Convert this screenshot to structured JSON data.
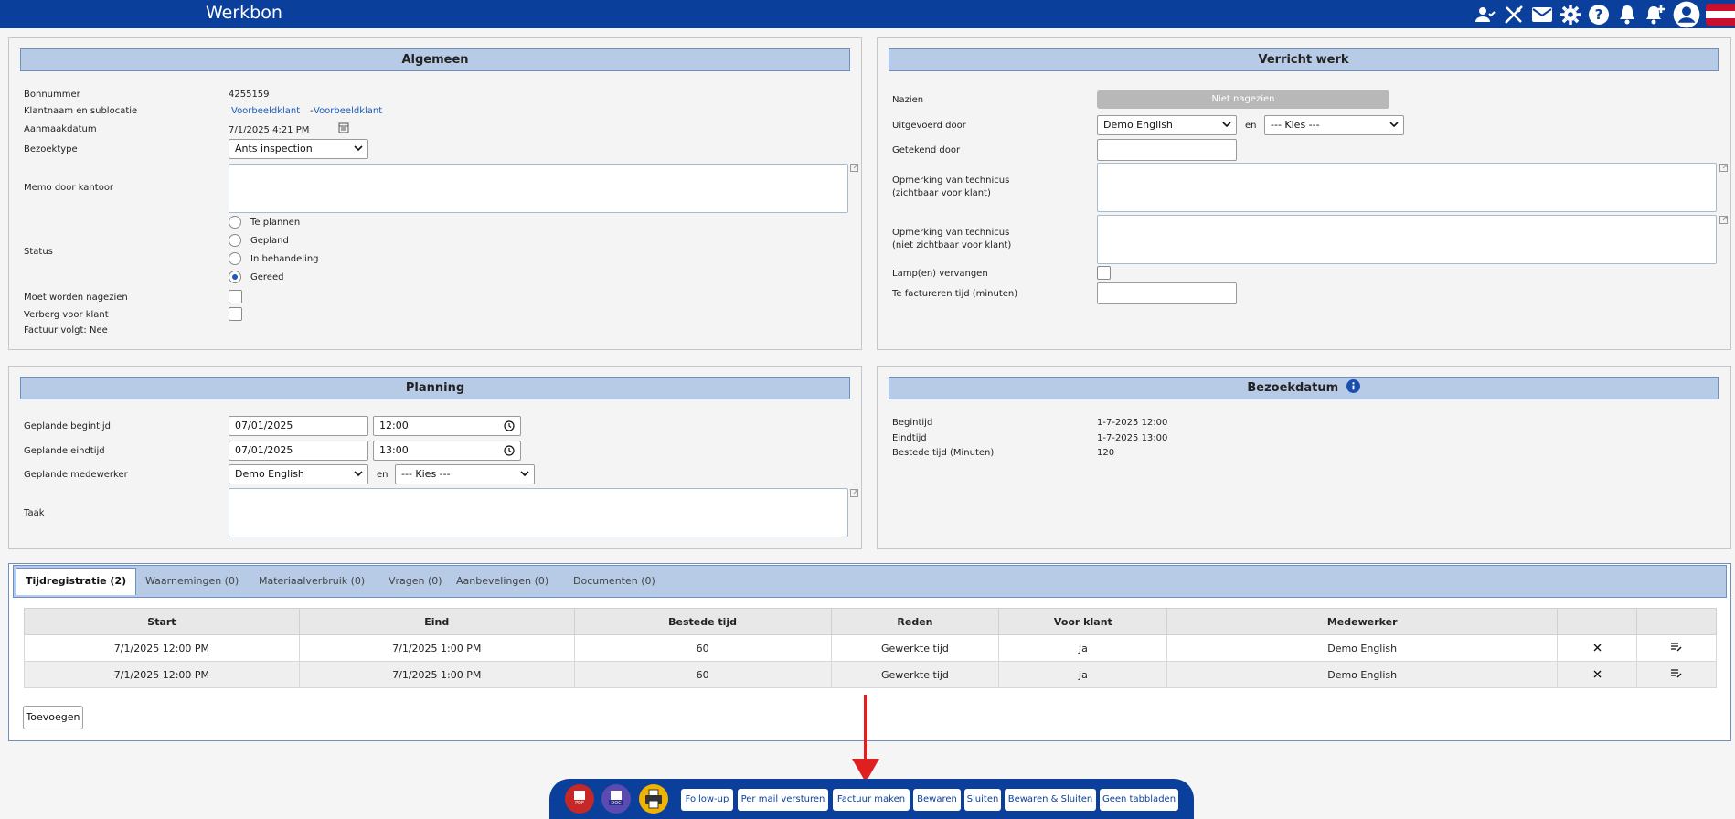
{
  "header": {
    "title": "Werkbon",
    "icons": [
      "users-icon",
      "tools-icon",
      "mail-icon",
      "gear-icon",
      "help-icon",
      "bell-icon",
      "bell-plus-icon",
      "account-icon",
      "flag-nl-icon"
    ]
  },
  "algemeen": {
    "title": "Algemeen",
    "bonnummer_label": "Bonnummer",
    "bonnummer": "4255159",
    "klant_label": "Klantnaam en sublocatie",
    "klant_name": "Voorbeeldklant",
    "klant_sep": "-",
    "klant_sublocation": "Voorbeeldklant",
    "aanmaak_label": "Aanmaakdatum",
    "aanmaak_value": "7/1/2025 4:21 PM",
    "bezoektype_label": "Bezoektype",
    "bezoektype_value": "Ants inspection",
    "memo_label": "Memo door kantoor",
    "status_label": "Status",
    "status_options": [
      "Te plannen",
      "Gepland",
      "In behandeling",
      "Gereed"
    ],
    "status_selected": "Gereed",
    "nagezien_label": "Moet worden nagezien",
    "verberg_label": "Verberg voor klant",
    "factuur_label": "Factuur volgt: Nee"
  },
  "verricht": {
    "title": "Verricht werk",
    "nazien_label": "Nazien",
    "nazien_button": "Niet nagezien",
    "uitgevoerd_label": "Uitgevoerd door",
    "uitgevoerd_value": "Demo English",
    "en": "en",
    "kies": "--- Kies ---",
    "getekend_label": "Getekend door",
    "opm1_line1": "Opmerking van technicus",
    "opm1_line2": "(zichtbaar voor klant)",
    "opm2_line1": "Opmerking van technicus",
    "opm2_line2": "(niet zichtbaar voor klant)",
    "lamp_label": "Lamp(en) vervangen",
    "factureren_label": "Te factureren tijd (minuten)"
  },
  "planning": {
    "title": "Planning",
    "begin_label": "Geplande begintijd",
    "begin_date": "07/01/2025",
    "begin_time": "12:00",
    "eind_label": "Geplande eindtijd",
    "eind_date": "07/01/2025",
    "eind_time": "13:00",
    "medewerker_label": "Geplande medewerker",
    "medewerker_value": "Demo English",
    "en": "en",
    "kies": "--- Kies ---",
    "taak_label": "Taak"
  },
  "bezoekdatum": {
    "title": "Bezoekdatum",
    "begintijd_label": "Begintijd",
    "begintijd": "1-7-2025 12:00",
    "eindtijd_label": "Eindtijd",
    "eindtijd": "1-7-2025 13:00",
    "bestede_label": "Bestede tijd (Minuten)",
    "bestede": "120"
  },
  "tabs": [
    {
      "label": "Tijdregistratie (2)"
    },
    {
      "label": "Waarnemingen (0)"
    },
    {
      "label": "Materiaalverbruik (0)"
    },
    {
      "label": "Vragen (0)"
    },
    {
      "label": "Aanbevelingen (0)"
    },
    {
      "label": "Documenten (0)"
    }
  ],
  "table": {
    "headers": [
      "Start",
      "Eind",
      "Bestede tijd",
      "Reden",
      "Voor klant",
      "Medewerker",
      "",
      ""
    ],
    "rows": [
      [
        "7/1/2025 12:00 PM",
        "7/1/2025 1:00 PM",
        "60",
        "Gewerkte tijd",
        "Ja",
        "Demo English"
      ],
      [
        "7/1/2025 12:00 PM",
        "7/1/2025 1:00 PM",
        "60",
        "Gewerkte tijd",
        "Ja",
        "Demo English"
      ]
    ],
    "add_button": "Toevoegen"
  },
  "toolbar": {
    "followup": "Follow-up",
    "mail": "Per mail versturen",
    "factuur": "Factuur maken",
    "bewaren": "Bewaren",
    "sluiten": "Sluiten",
    "bewaren_sluiten": "Bewaren & Sluiten",
    "geen_tabbladen": "Geen tabbladen"
  },
  "colors": {
    "brand": "#0a3f9b",
    "header_fill": "#b7cbe7",
    "arrow": "#e02020"
  }
}
